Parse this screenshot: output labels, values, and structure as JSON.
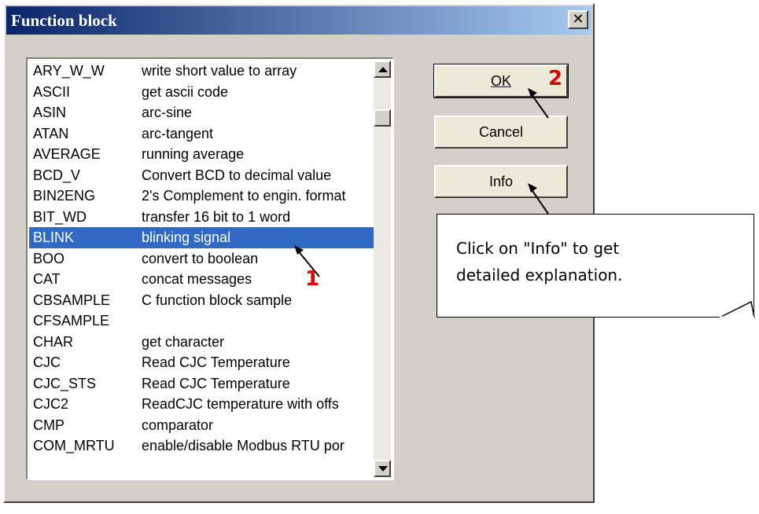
{
  "dialog": {
    "title": "Function block",
    "close_label": "✕"
  },
  "list": {
    "selected_index": 8,
    "items": [
      {
        "name": "ARY_W_W",
        "desc": "write short value to array"
      },
      {
        "name": "ASCII",
        "desc": "get ascii code"
      },
      {
        "name": "ASIN",
        "desc": "arc-sine"
      },
      {
        "name": "ATAN",
        "desc": "arc-tangent"
      },
      {
        "name": "AVERAGE",
        "desc": "running average"
      },
      {
        "name": "BCD_V",
        "desc": "Convert BCD to decimal value"
      },
      {
        "name": "BIN2ENG",
        "desc": "2's Complement to engin. format"
      },
      {
        "name": "BIT_WD",
        "desc": "transfer 16 bit to 1 word"
      },
      {
        "name": "BLINK",
        "desc": "blinking signal"
      },
      {
        "name": "BOO",
        "desc": "convert to boolean"
      },
      {
        "name": "CAT",
        "desc": "concat messages"
      },
      {
        "name": "CBSAMPLE",
        "desc": "C function block sample"
      },
      {
        "name": "CFSAMPLE",
        "desc": ""
      },
      {
        "name": "CHAR",
        "desc": "get character"
      },
      {
        "name": "CJC",
        "desc": "Read CJC Temperature"
      },
      {
        "name": "CJC_STS",
        "desc": "Read CJC Temperature"
      },
      {
        "name": "CJC2",
        "desc": "ReadCJC temperature with offs"
      },
      {
        "name": "CMP",
        "desc": "comparator"
      },
      {
        "name": "COM_MRTU",
        "desc": "enable/disable Modbus RTU por"
      },
      {
        "name": "",
        "desc": ""
      }
    ]
  },
  "buttons": {
    "ok": "OK",
    "cancel": "Cancel",
    "info": "Info"
  },
  "callout": {
    "line1": "Click on \"Info\" to get",
    "line2": "detailed explanation."
  },
  "markers": {
    "one": "1",
    "two": "2"
  },
  "icons": {
    "scroll_up": "triangle-up-icon",
    "scroll_down": "triangle-down-icon",
    "close": "close-icon"
  }
}
